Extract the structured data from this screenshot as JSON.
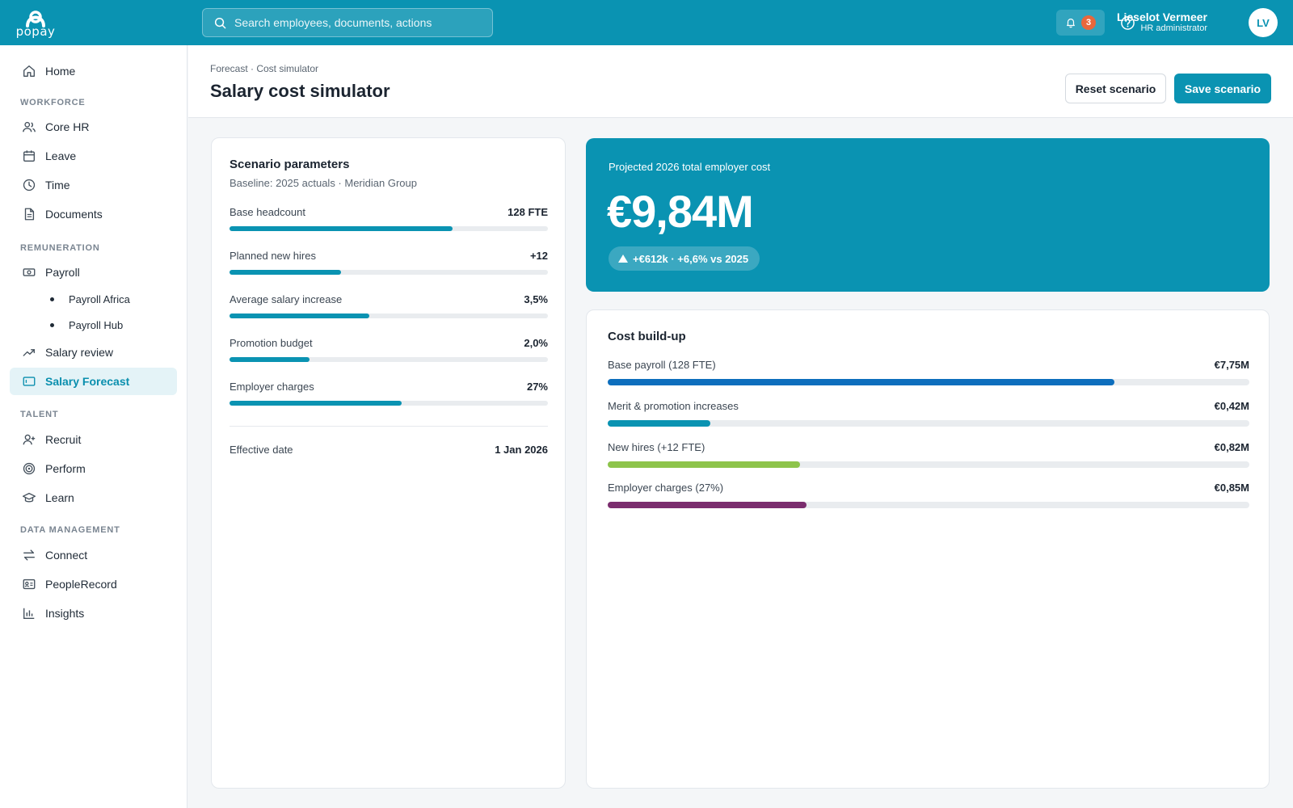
{
  "app": {
    "logo_text": "popay",
    "search_placeholder": "Search employees, documents, actions",
    "notification_count": "3",
    "user": {
      "name": "Lieselot Vermeer",
      "role": "HR administrator",
      "initials": "LV"
    }
  },
  "sidebar": {
    "home": "Home",
    "sections": {
      "workforce": "WORKFORCE",
      "remuneration": "REMUNERATION",
      "talent": "TALENT",
      "data_management": "DATA MANAGEMENT"
    },
    "items": {
      "core_hr": "Core HR",
      "leave": "Leave",
      "time": "Time",
      "documents": "Documents",
      "payroll": "Payroll",
      "payroll_africa": "Payroll Africa",
      "payroll_hub": "Payroll Hub",
      "salary_review": "Salary review",
      "salary_forecast": "Salary Forecast",
      "recruit": "Recruit",
      "perform": "Perform",
      "learn": "Learn",
      "connect": "Connect",
      "people_record": "PeopleRecord",
      "insights": "Insights"
    }
  },
  "page": {
    "breadcrumb": "Forecast · Cost simulator",
    "title": "Salary cost simulator",
    "reset_label": "Reset scenario",
    "save_label": "Save scenario"
  },
  "params": {
    "title": "Scenario parameters",
    "subtitle": "Baseline: 2025 actuals · Meridian Group",
    "items": [
      {
        "label": "Base headcount",
        "value": "128 FTE",
        "level": 0.7
      },
      {
        "label": "Planned new hires",
        "value": "+12",
        "level": 0.35
      },
      {
        "label": "Average salary increase",
        "value": "3,5%",
        "level": 0.44
      },
      {
        "label": "Promotion budget",
        "value": "2,0%",
        "level": 0.25
      },
      {
        "label": "Employer charges",
        "value": "27%",
        "level": 0.54
      }
    ],
    "effective_label": "Effective date",
    "effective_value": "1 Jan 2026"
  },
  "projection": {
    "label": "Projected 2026 total employer cost",
    "value": "€9,84M",
    "delta": "+€612k · +6,6% vs 2025"
  },
  "buildup": {
    "title": "Cost build-up",
    "items": [
      {
        "label": "Base payroll (128 FTE)",
        "value": "€7,75M",
        "level": 0.79,
        "color": "#0d6ebd"
      },
      {
        "label": "Merit & promotion increases",
        "value": "€0,42M",
        "level": 0.16,
        "color": "#0a93b2"
      },
      {
        "label": "New hires (+12 FTE)",
        "value": "€0,82M",
        "level": 0.3,
        "color": "#8dc44b"
      },
      {
        "label": "Employer charges (27%)",
        "value": "€0,85M",
        "level": 0.31,
        "color": "#7b2d6e"
      }
    ]
  }
}
